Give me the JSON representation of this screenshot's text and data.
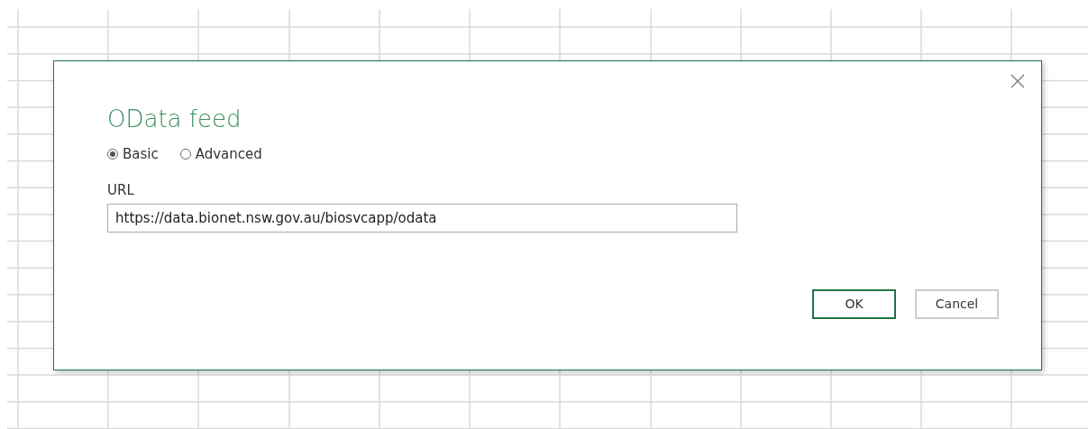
{
  "dialog": {
    "title": "OData feed",
    "modes": [
      {
        "label": "Basic",
        "selected": true
      },
      {
        "label": "Advanced",
        "selected": false
      }
    ],
    "url_field": {
      "label": "URL",
      "value": "https://data.bionet.nsw.gov.au/biosvcapp/odata"
    },
    "buttons": [
      {
        "label": "OK",
        "kind": "primary"
      },
      {
        "label": "Cancel",
        "kind": "secondary"
      }
    ]
  }
}
